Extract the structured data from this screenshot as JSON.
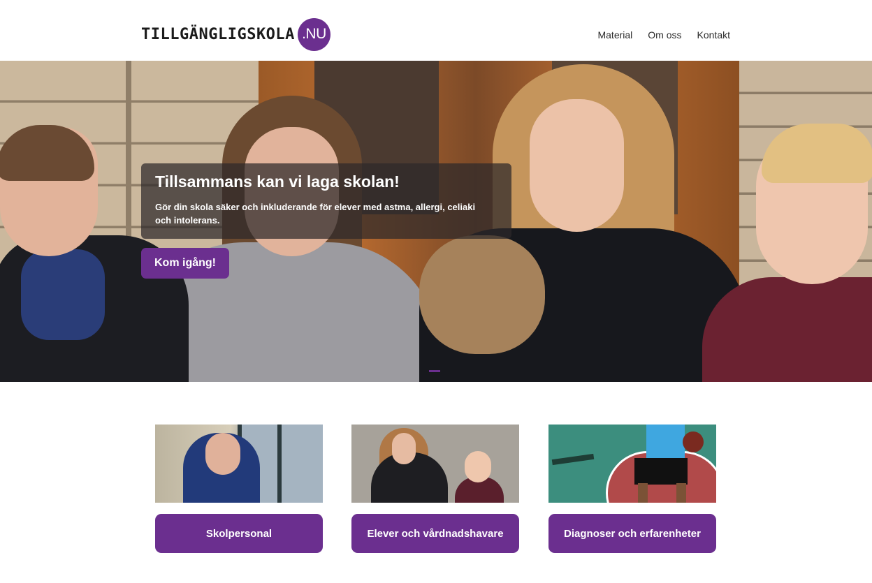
{
  "header": {
    "logo_text": "TILLGÄNGLIGSKOLA",
    "logo_badge": ".NU",
    "nav": [
      "Material",
      "Om oss",
      "Kontakt"
    ]
  },
  "hero": {
    "title": "Tillsammans kan vi laga skolan!",
    "subtitle": "Gör din skola säker och inkluderande för elever med astma, allergi, celiaki och intolerans.",
    "cta_label": "Kom igång!"
  },
  "cards": [
    {
      "label": "Skolpersonal"
    },
    {
      "label": "Elever och vårdnadshavare"
    },
    {
      "label": "Diagnoser och erfarenheter"
    }
  ],
  "colors": {
    "brand_purple": "#6b2f8f",
    "text_dark": "#1b1b1b",
    "background": "#ffffff"
  }
}
